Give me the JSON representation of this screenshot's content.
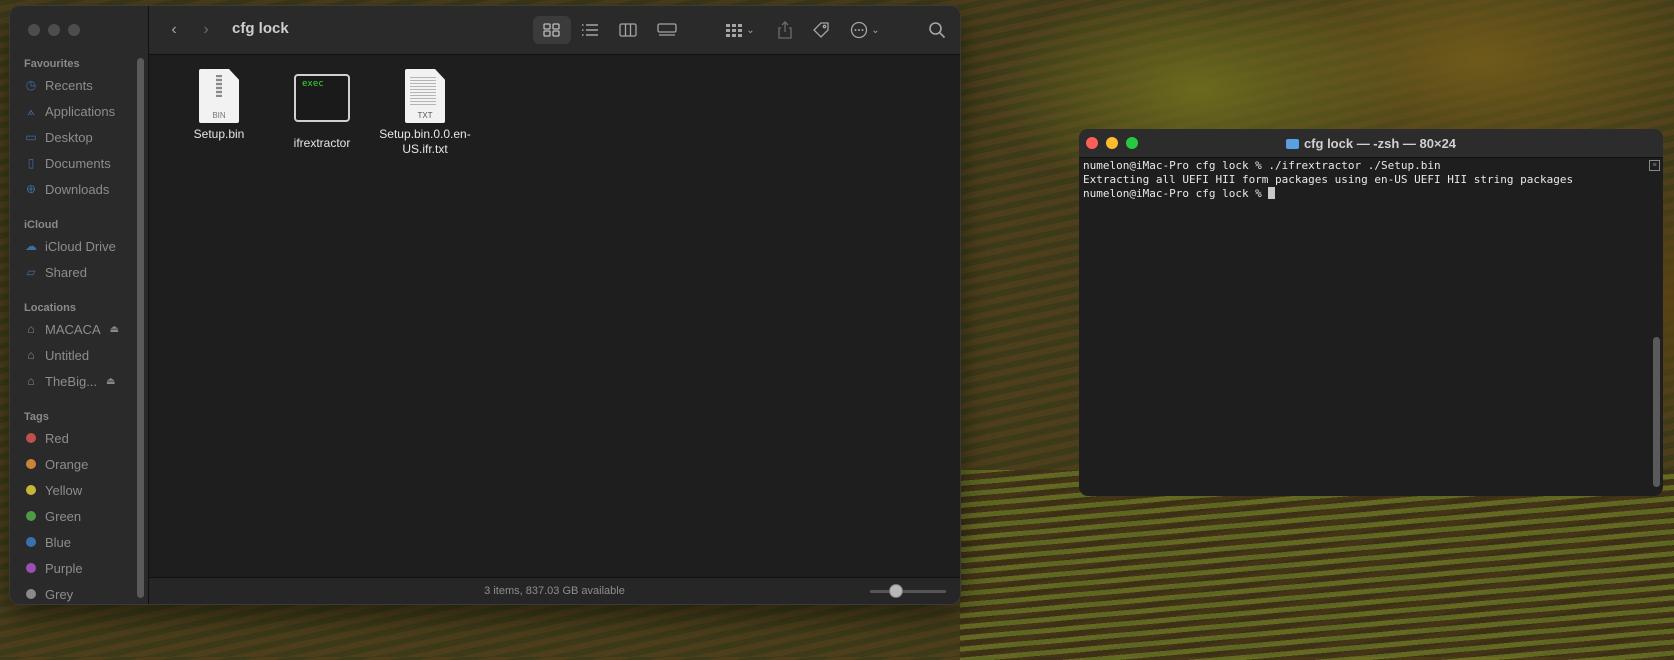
{
  "finder": {
    "title": "cfg lock",
    "sidebar": {
      "favourites_heading": "Favourites",
      "favourites": [
        {
          "label": "Recents",
          "icon": "clock-icon"
        },
        {
          "label": "Applications",
          "icon": "applications-icon"
        },
        {
          "label": "Desktop",
          "icon": "desktop-icon"
        },
        {
          "label": "Documents",
          "icon": "document-icon"
        },
        {
          "label": "Downloads",
          "icon": "download-icon"
        }
      ],
      "icloud_heading": "iCloud",
      "icloud": [
        {
          "label": "iCloud Drive",
          "icon": "cloud-icon"
        },
        {
          "label": "Shared",
          "icon": "shared-folder-icon"
        }
      ],
      "locations_heading": "Locations",
      "locations": [
        {
          "label": "MACACA",
          "icon": "drive-icon",
          "eject": true
        },
        {
          "label": "Untitled",
          "icon": "drive-icon",
          "eject": false
        },
        {
          "label": "TheBig...",
          "icon": "drive-icon",
          "eject": true
        }
      ],
      "tags_heading": "Tags",
      "tags": [
        {
          "label": "Red",
          "color": "#c0504d"
        },
        {
          "label": "Orange",
          "color": "#c9843a"
        },
        {
          "label": "Yellow",
          "color": "#c7b53a"
        },
        {
          "label": "Green",
          "color": "#4e9a45"
        },
        {
          "label": "Blue",
          "color": "#3a6fb0"
        },
        {
          "label": "Purple",
          "color": "#9b4fb5"
        },
        {
          "label": "Grey",
          "color": "#8a8a8a"
        }
      ]
    },
    "files": [
      {
        "label": "Setup.bin",
        "icon": "bin-file-icon",
        "badge": "BIN"
      },
      {
        "label": "ifrextractor",
        "icon": "exec-file-icon",
        "badge": "exec"
      },
      {
        "label": "Setup.bin.0.0.en-US.ifr.txt",
        "label_line1": "Setup.bin.0.0.en-",
        "label_line2": "US.ifr.txt",
        "icon": "txt-file-icon",
        "badge": "TXT"
      }
    ],
    "status": "3 items, 837.03 GB available",
    "icon_size_fraction": 0.3
  },
  "terminal": {
    "title": "cfg lock — -zsh — 80×24",
    "lines": [
      "numelon@iMac-Pro cfg lock % ./ifrextractor ./Setup.bin",
      "Extracting all UEFI HII form packages using en-US UEFI HII string packages",
      "numelon@iMac-Pro cfg lock % "
    ],
    "traffic_colors": [
      "#fe5f57",
      "#febc2e",
      "#28c840"
    ]
  }
}
